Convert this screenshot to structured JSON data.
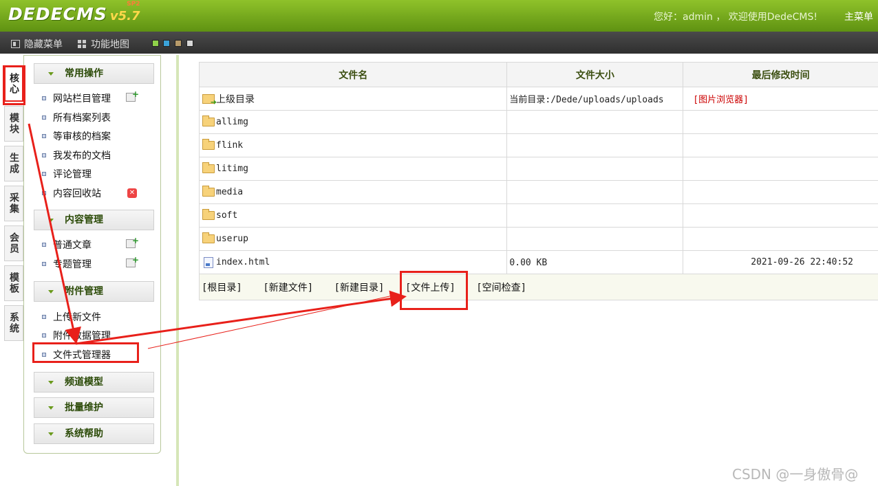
{
  "header": {
    "logo_text": "DEDECMS",
    "version": "v5.7",
    "version_tag": "SP2",
    "welcome": "您好：admin ， 欢迎使用DedeCMS!",
    "main_menu": "主菜单"
  },
  "toolbar": {
    "hide_menu": "隐藏菜单",
    "site_map": "功能地图",
    "theme_swatches": [
      "#8fd14a",
      "#3ba3d9",
      "#b89b6a",
      "#d8d8d8"
    ]
  },
  "vtabs": [
    "核心",
    "模块",
    "生成",
    "采集",
    "会员",
    "模板",
    "系统"
  ],
  "sidebar": {
    "groups": [
      {
        "title": "常用操作",
        "items": [
          "网站栏目管理",
          "所有档案列表",
          "等审核的档案",
          "我发布的文档",
          "评论管理",
          "内容回收站"
        ]
      },
      {
        "title": "内容管理",
        "items": [
          "普通文章",
          "专题管理"
        ]
      },
      {
        "title": "附件管理",
        "items": [
          "上传新文件",
          "附件数据管理",
          "文件式管理器"
        ]
      },
      {
        "title": "频道模型",
        "items": []
      },
      {
        "title": "批量维护",
        "items": []
      },
      {
        "title": "系统帮助",
        "items": []
      }
    ]
  },
  "table": {
    "headers": [
      "文件名",
      "文件大小",
      "最后修改时间"
    ],
    "parent_dir": "上级目录",
    "current_dir": "当前目录:/Dede/uploads/uploads",
    "image_browser": "[图片浏览器]",
    "folders": [
      "allimg",
      "flink",
      "litimg",
      "media",
      "soft",
      "userup"
    ],
    "files": [
      {
        "name": "index.html",
        "size": "0.00 KB",
        "modified": "2021-09-26 22:40:52"
      }
    ],
    "actions": [
      "[根目录]",
      "[新建文件]",
      "[新建目录]",
      "[文件上传]",
      "[空间检查]"
    ]
  },
  "watermark": "CSDN @一身傲骨@"
}
